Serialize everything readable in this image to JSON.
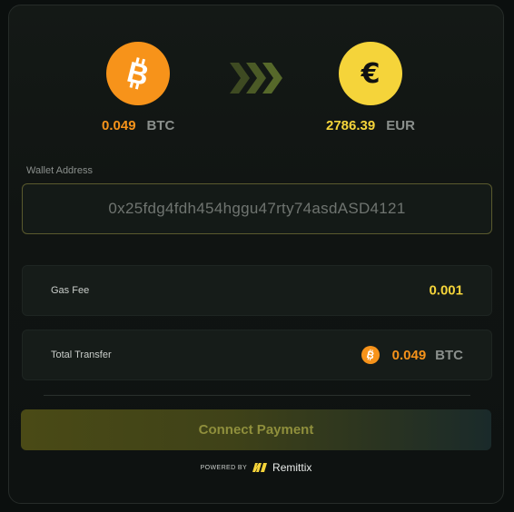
{
  "exchange": {
    "from": {
      "amount": "0.049",
      "unit": "BTC",
      "icon": "bitcoin-icon",
      "color": "#f7931a"
    },
    "to": {
      "amount": "2786.39",
      "unit": "EUR",
      "icon": "euro-icon",
      "color": "#f5d43a"
    },
    "arrow_icon": "triple-chevron-right-icon"
  },
  "wallet": {
    "label": "Wallet Address",
    "value": "0x25fdg4fdh454hggu47rty74asdASD4121"
  },
  "gas_fee": {
    "label": "Gas Fee",
    "value": "0.001"
  },
  "total_transfer": {
    "label": "Total Transfer",
    "amount": "0.049",
    "unit": "BTC",
    "icon": "bitcoin-icon"
  },
  "connect_button": {
    "label": "Connect Payment"
  },
  "footer": {
    "powered_by": "POWERED BY",
    "brand": "Remittix",
    "brand_icon": "remittix-logo-icon"
  },
  "colors": {
    "btc_orange": "#f7931a",
    "eur_yellow": "#f5d43a",
    "accent_olive": "#5a5a2e"
  }
}
